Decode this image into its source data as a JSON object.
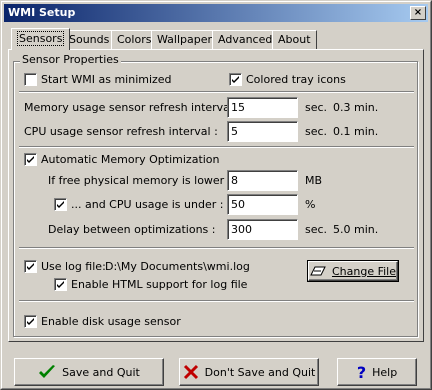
{
  "window": {
    "title": "WMI Setup",
    "close_glyph": "×"
  },
  "tabs": [
    {
      "label": "Sensors",
      "active": true
    },
    {
      "label": "Sounds"
    },
    {
      "label": "Colors"
    },
    {
      "label": "Wallpaper"
    },
    {
      "label": "Advanced"
    },
    {
      "label": "About"
    }
  ],
  "group": {
    "label": "Sensor Properties"
  },
  "options": {
    "start_minimized": {
      "label": "Start WMI as minimized",
      "checked": false
    },
    "colored_tray": {
      "label": "Colored tray icons",
      "checked": true
    }
  },
  "memory_refresh": {
    "label": "Memory usage sensor refresh interval :",
    "value": "15",
    "unit": "sec.",
    "extra": "0.3 min."
  },
  "cpu_refresh": {
    "label": "CPU usage sensor refresh interval :",
    "value": "5",
    "unit": "sec.",
    "extra": "0.1 min."
  },
  "auto_mem": {
    "label": "Automatic Memory Optimization",
    "checked": true
  },
  "free_mem": {
    "label": "If free physical memory is lower than :",
    "value": "8",
    "unit": "MB"
  },
  "cpu_under": {
    "label": "... and CPU usage is under :",
    "value": "50",
    "unit": "%",
    "checked": true
  },
  "delay": {
    "label": "Delay between optimizations :",
    "value": "300",
    "unit": "sec.",
    "extra": "5.0 min."
  },
  "log": {
    "label": "Use log file:",
    "checked": true,
    "path": "D:\\My Documents\\wmi.log",
    "change_label": "Change File",
    "html_label": "Enable HTML support for log file",
    "html_checked": true
  },
  "disk": {
    "label": "Enable disk usage sensor",
    "checked": true
  },
  "buttons": {
    "save": "Save and Quit",
    "dont_save": "Don't Save and Quit",
    "help": "Help"
  },
  "icons": {
    "check": "checkmark-icon",
    "cross": "red-x-icon",
    "help": "question-mark-icon",
    "file": "file-icon"
  },
  "colors": {
    "check_green": "#008000",
    "cross_red": "#c00000",
    "help_blue": "#0000c0"
  }
}
